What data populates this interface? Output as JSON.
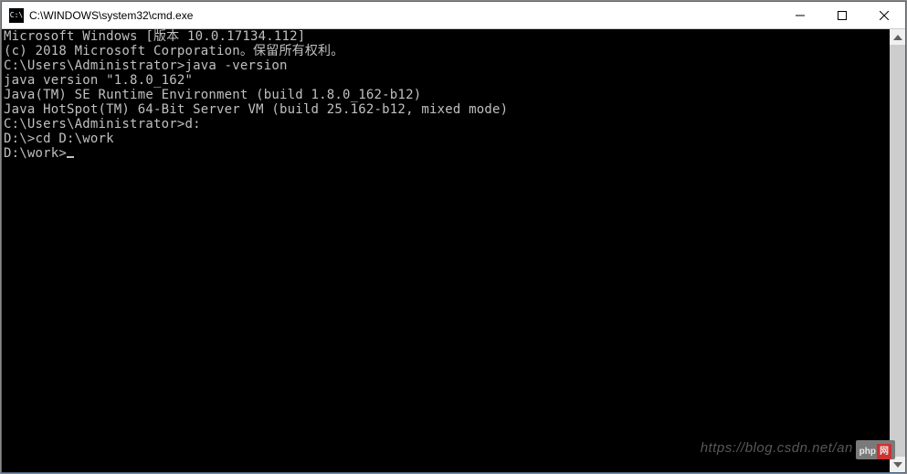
{
  "titlebar": {
    "icon_text": "C:\\",
    "title": "C:\\WINDOWS\\system32\\cmd.exe"
  },
  "console": {
    "lines": [
      "Microsoft Windows [版本 10.0.17134.112]",
      "(c) 2018 Microsoft Corporation。保留所有权利。",
      "",
      "C:\\Users\\Administrator>java -version",
      "java version \"1.8.0_162\"",
      "Java(TM) SE Runtime Environment (build 1.8.0_162-b12)",
      "Java HotSpot(TM) 64-Bit Server VM (build 25.162-b12, mixed mode)",
      "",
      "C:\\Users\\Administrator>d:",
      "",
      "D:\\>cd D:\\work",
      "",
      "D:\\work>"
    ],
    "current_prompt": "D:\\work>"
  },
  "watermark": {
    "text": "https://blog.csdn.net/an      021",
    "badge_left": "php",
    "badge_right": "网"
  }
}
